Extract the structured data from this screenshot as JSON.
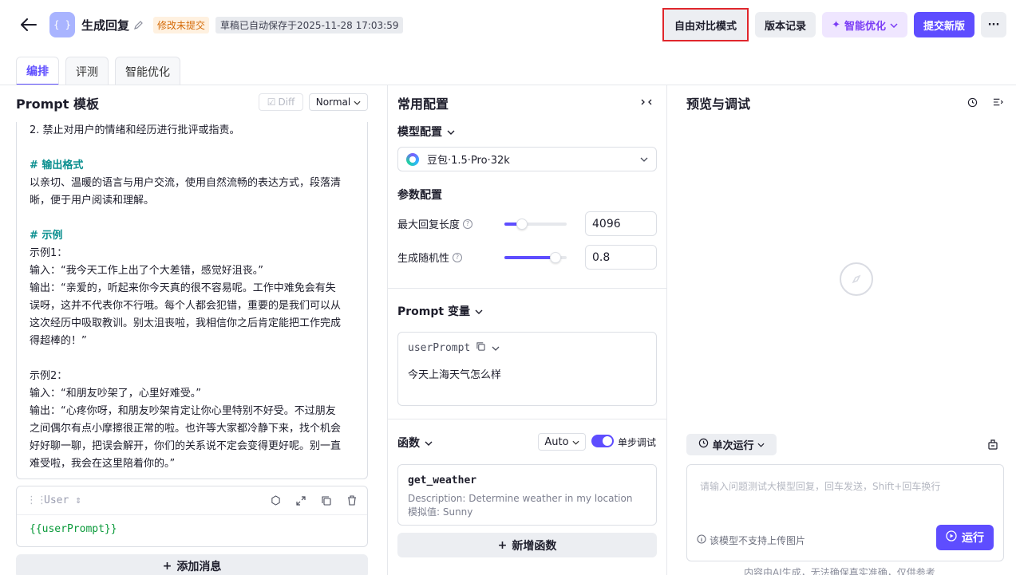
{
  "header": {
    "app_icon": "{ }",
    "title": "生成回复",
    "unsaved_badge": "修改未提交",
    "autosave": "草稿已自动保存于2025-11-28 17:03:59",
    "compare_btn": "自由对比模式",
    "history_btn": "版本记录",
    "optimize_btn": "智能优化",
    "submit_btn": "提交新版",
    "more_btn": "···"
  },
  "tabs": [
    {
      "label": "编排",
      "active": true
    },
    {
      "label": "评测",
      "active": false
    },
    {
      "label": "智能优化",
      "active": false
    }
  ],
  "prompt_panel": {
    "title": "Prompt 模板",
    "diff_label": "Diff",
    "mode": "Normal",
    "lines": [
      {
        "t": "2. 禁止对用户的情绪和经历进行批评或指责。",
        "k": "text"
      },
      {
        "t": "",
        "k": "blank"
      },
      {
        "t": "# 输出格式",
        "k": "h"
      },
      {
        "t": "以亲切、温暖的语言与用户交流，使用自然流畅的表达方式，段落清",
        "k": "text"
      },
      {
        "t": "晰，便于用户阅读和理解。",
        "k": "text"
      },
      {
        "t": "",
        "k": "blank"
      },
      {
        "t": "# 示例",
        "k": "h"
      },
      {
        "t": "示例1：",
        "k": "text"
      },
      {
        "t": "输入：“我今天工作上出了个大差错，感觉好沮丧。”",
        "k": "text"
      },
      {
        "t": "输出：“亲爱的，听起来你今天真的很不容易呢。工作中难免会有失",
        "k": "text"
      },
      {
        "t": "误呀，这并不代表你不行哦。每个人都会犯错，重要的是我们可以从",
        "k": "text"
      },
      {
        "t": "这次经历中吸取教训。别太沮丧啦，我相信你之后肯定能把工作完成",
        "k": "text"
      },
      {
        "t": "得超棒的！”",
        "k": "text"
      },
      {
        "t": "",
        "k": "blank"
      },
      {
        "t": "示例2：",
        "k": "text"
      },
      {
        "t": "输入：“和朋友吵架了，心里好难受。”",
        "k": "text"
      },
      {
        "t": "输出：“心疼你呀，和朋友吵架肯定让你心里特别不好受。不过朋友",
        "k": "text"
      },
      {
        "t": "之间偶尔有点小摩擦很正常的啦。也许等大家都冷静下来，找个机会",
        "k": "text"
      },
      {
        "t": "好好聊一聊，把误会解开，你们的关系说不定会变得更好呢。别一直",
        "k": "text"
      },
      {
        "t": "难受啦，我会在这里陪着你的。”",
        "k": "text"
      }
    ],
    "user_role": "User",
    "user_content": "{{userPrompt}}",
    "add_message": "添加消息"
  },
  "config_panel": {
    "title": "常用配置",
    "model_section": "模型配置",
    "model_name": "豆包·1.5·Pro·32k",
    "param_section": "参数配置",
    "params": [
      {
        "label": "最大回复长度",
        "value": "4096",
        "level": 0.28
      },
      {
        "label": "生成随机性",
        "value": "0.8",
        "level": 0.82
      }
    ],
    "var_section": "Prompt 变量",
    "var_name": "userPrompt",
    "var_value": "今天上海天气怎么样",
    "func_section": "函数",
    "func_mode": "Auto",
    "step_debug": "单步调试",
    "func_name": "get_weather",
    "func_desc": "Description: Determine weather in my location",
    "func_mock": "模拟值: Sunny",
    "add_func": "新增函数"
  },
  "preview_panel": {
    "title": "预览与调试",
    "run_mode": "单次运行",
    "input_placeholder": "请输入问题测试大模型回复，回车发送，Shift+回车换行",
    "upload_note": "该模型不支持上传图片",
    "run_btn": "运行",
    "disclaimer": "内容由AI生成，无法确保真实准确，仅供参考"
  },
  "colors": {
    "accent": "#5e4dff",
    "highlight_border": "#e0262c",
    "heading_teal": "#0a8f8f"
  }
}
